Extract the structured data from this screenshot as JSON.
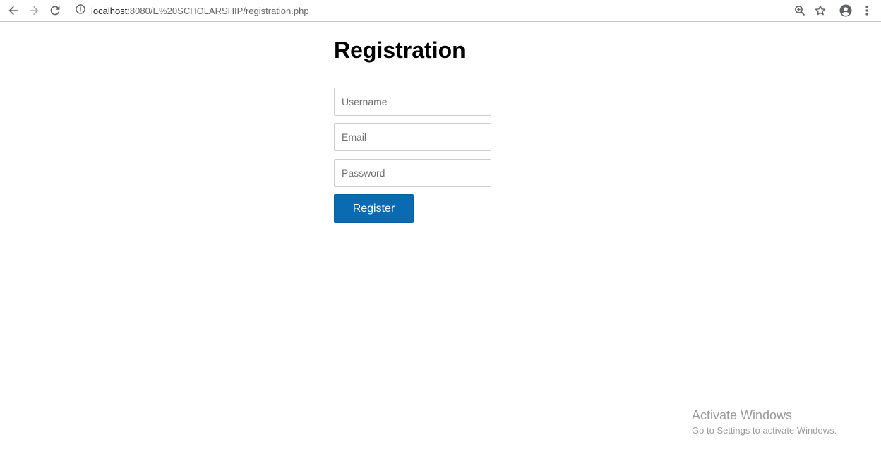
{
  "browser": {
    "url_host": "localhost",
    "url_rest": ":8080/E%20SCHOLARSHIP/registration.php",
    "icons": [
      "back-arrow-icon",
      "forward-arrow-icon",
      "reload-icon",
      "info-icon",
      "zoom-icon",
      "star-icon",
      "account-icon",
      "menu-dots-icon"
    ]
  },
  "page": {
    "title": "Registration",
    "username_placeholder": "Username",
    "email_placeholder": "Email",
    "password_placeholder": "Password",
    "register_label": "Register"
  },
  "watermark": {
    "title": "Activate Windows",
    "subtitle": "Go to Settings to activate Windows."
  },
  "colors": {
    "button": "#0a6bb3",
    "field_border": "#cccccc",
    "watermark": "#9a9a9a"
  }
}
